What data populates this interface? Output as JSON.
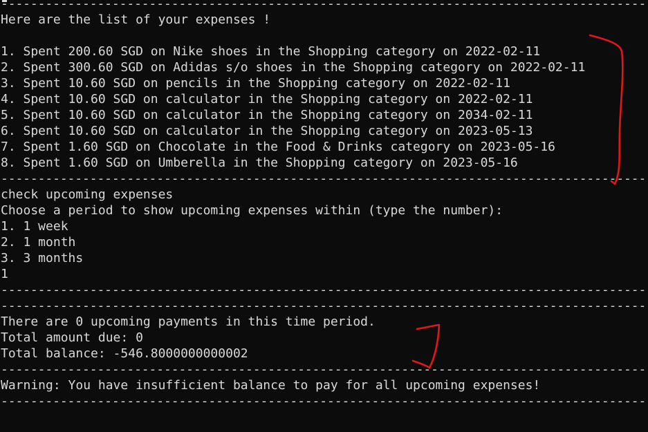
{
  "separator": "-------------------------------------------------------------------------------------------",
  "expenses": {
    "heading": "Here are the list of your expenses !",
    "items": [
      "1. Spent 200.60 SGD on Nike shoes in the Shopping category on 2022-02-11",
      "2. Spent 300.60 SGD on Adidas s/o shoes in the Shopping category on 2022-02-11",
      "3. Spent 10.60 SGD on pencils in the Shopping category on 2022-02-11",
      "4. Spent 10.60 SGD on calculator in the Shopping category on 2022-02-11",
      "5. Spent 10.60 SGD on calculator in the Shopping category on 2034-02-11",
      "6. Spent 10.60 SGD on calculator in the Shopping category on 2023-05-13",
      "7. Spent 1.60 SGD on Chocolate in the Food & Drinks category on 2023-05-16",
      "8. Spent 1.60 SGD on Umberella in the Shopping category on 2023-05-16"
    ]
  },
  "upcoming": {
    "command": "check upcoming expenses",
    "prompt": "Choose a period to show upcoming expenses within (type the number):",
    "options": [
      "1. 1 week",
      "2. 1 month",
      "3. 3 months"
    ],
    "user_input": "1"
  },
  "result": {
    "payments_line": "There are 0 upcoming payments in this time period.",
    "amount_due_line": "Total amount due: 0",
    "balance_line": "Total balance: -546.8000000000002"
  },
  "warning": "Warning: You have insufficient balance to pay for all upcoming expenses!",
  "colors": {
    "background": "#0c0c0c",
    "text": "#d9d9d9",
    "annotation": "#e01818"
  }
}
